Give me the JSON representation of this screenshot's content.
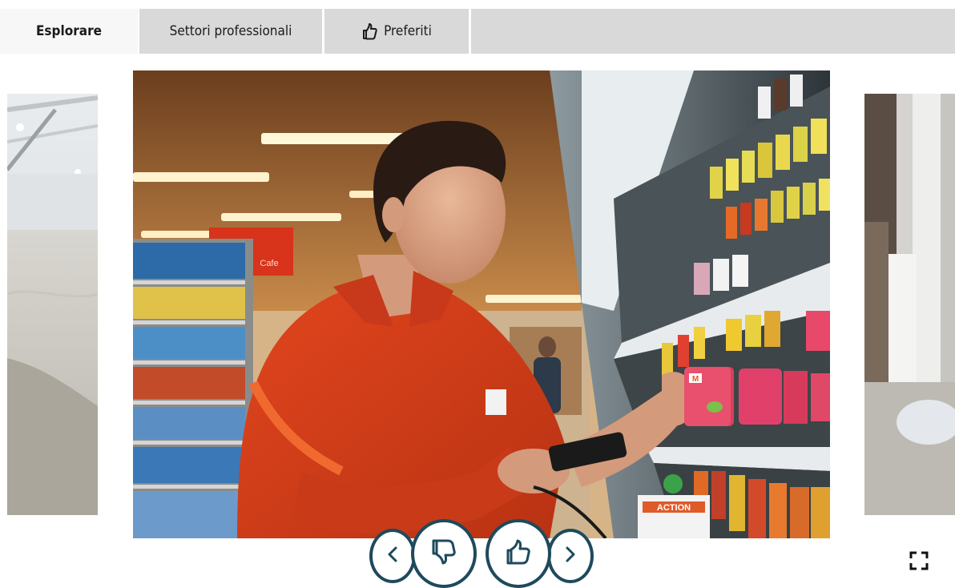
{
  "tabs": [
    {
      "label": "Esplorare",
      "active": true
    },
    {
      "label": "Settori professionali",
      "active": false
    },
    {
      "label": "Preferiti",
      "active": false,
      "icon": "thumbs-up-icon"
    }
  ],
  "main_slide": {
    "shelf_sign": "Cafe",
    "action_sign": "ACTION",
    "product_logo": "M"
  },
  "controls": {
    "prev_icon": "chevron-left-icon",
    "dislike_icon": "thumbs-down-icon",
    "like_icon": "thumbs-up-icon",
    "next_icon": "chevron-right-icon",
    "fullscreen_icon": "fullscreen-icon"
  },
  "colors": {
    "accent": "#1e4a5c",
    "tab_inactive": "#d9d9d9",
    "tab_active": "#f7f7f7"
  }
}
